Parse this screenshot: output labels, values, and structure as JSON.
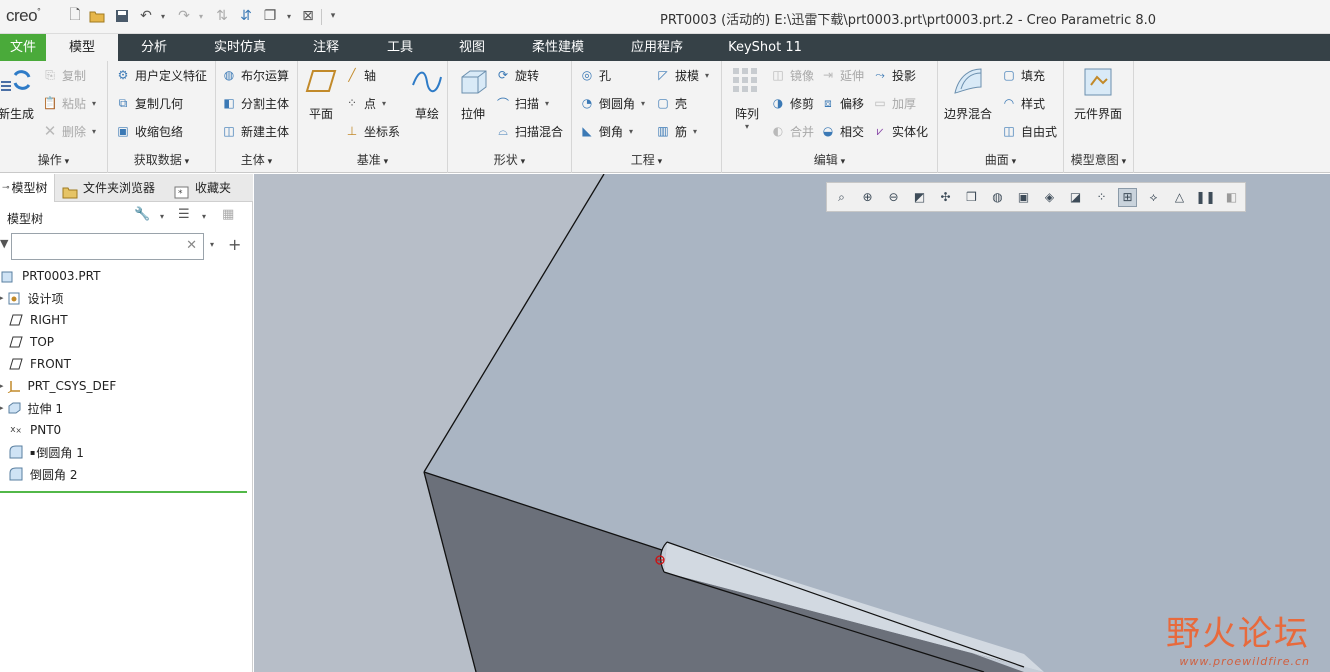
{
  "app": {
    "logo": "creo",
    "window_title": "PRT0003 (活动的) E:\\迅雷下载\\prt0003.prt\\prt0003.prt.2 - Creo Parametric 8.0"
  },
  "tabs": [
    "文件",
    "模型",
    "分析",
    "实时仿真",
    "注释",
    "工具",
    "视图",
    "柔性建模",
    "应用程序",
    "KeyShot 11"
  ],
  "active_tab": "模型",
  "ribbon": {
    "operations": {
      "label": "操作",
      "regenerate": "新生成",
      "copy": "复制",
      "paste": "粘贴",
      "delete": "删除"
    },
    "get_data": {
      "label": "获取数据",
      "udf": "用户定义特征",
      "copy_geom": "复制几何",
      "shrinkwrap": "收缩包络"
    },
    "body": {
      "label": "主体",
      "boolean": "布尔运算",
      "split": "分割主体",
      "new_body": "新建主体"
    },
    "datum": {
      "label": "基准",
      "plane": "平面",
      "axis": "轴",
      "point": "点",
      "csys": "坐标系",
      "sketch": "草绘"
    },
    "shapes": {
      "label": "形状",
      "extrude": "拉伸",
      "revolve": "旋转",
      "sweep": "扫描",
      "swept_blend": "扫描混合"
    },
    "engineering": {
      "label": "工程",
      "hole": "孔",
      "draft": "拔模",
      "round": "倒圆角",
      "shell": "壳",
      "chamfer": "倒角",
      "rib": "筋"
    },
    "editing": {
      "label": "编辑",
      "pattern": "阵列",
      "mirror": "镜像",
      "extend": "延伸",
      "project": "投影",
      "trim": "修剪",
      "offset": "偏移",
      "thicken": "加厚",
      "merge": "合并",
      "intersect": "相交",
      "solidify": "实体化"
    },
    "surfaces": {
      "label": "曲面",
      "boundary_blend": "边界混合",
      "fill": "填充",
      "style": "样式",
      "freestyle": "自由式"
    },
    "model_intent": {
      "label": "模型意图",
      "component_interface": "元件界面"
    }
  },
  "panel": {
    "tabs": [
      "模型树",
      "文件夹浏览器",
      "收藏夹"
    ],
    "tree_header": "模型树",
    "search_placeholder": "",
    "tree_items": [
      "PRT0003.PRT",
      "设计项",
      "RIGHT",
      "TOP",
      "FRONT",
      "PRT_CSYS_DEF",
      "拉伸 1",
      "PNT0",
      "倒圆角 1",
      "倒圆角 2"
    ]
  },
  "graphics": {
    "background": "#b7bec8",
    "watermark_main": "野火论坛",
    "watermark_sub": "www.proewildfire.cn"
  },
  "colors": {
    "file_tab": "#4aaa3a",
    "tab_bar": "#364147",
    "ribbon": "#f3f3f3",
    "insert_line": "#52b848"
  }
}
